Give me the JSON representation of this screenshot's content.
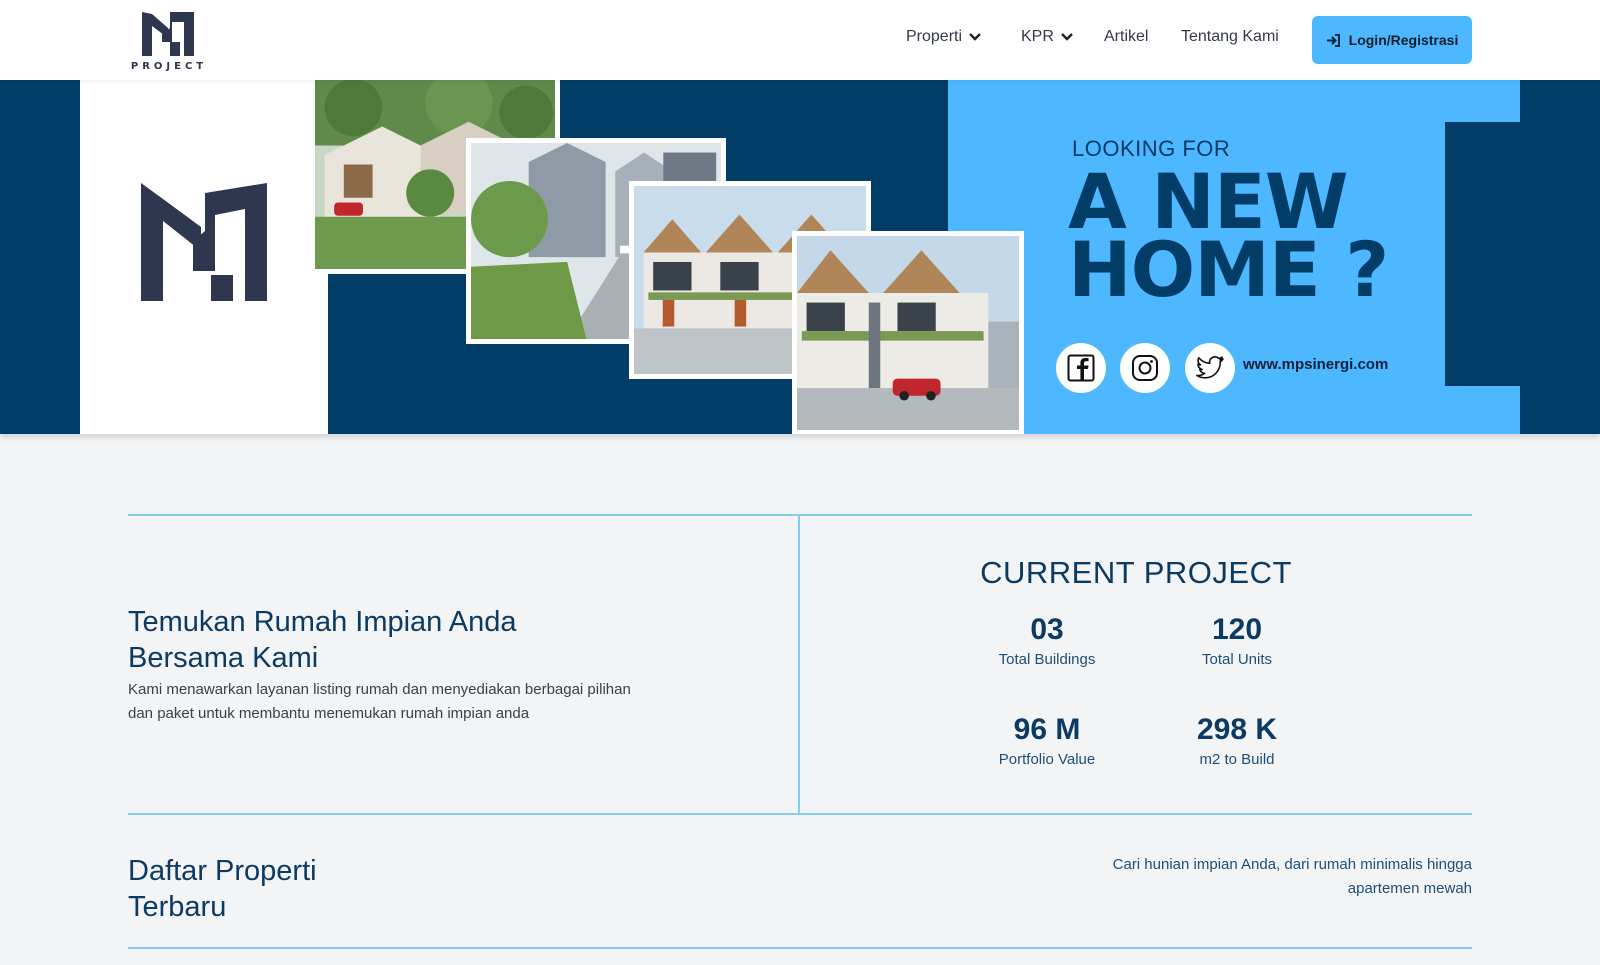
{
  "navbar": {
    "brand_text": "PROJECT",
    "items": [
      {
        "label": "Properti",
        "dropdown": true
      },
      {
        "label": "KPR",
        "dropdown": true
      },
      {
        "label": "Artikel",
        "dropdown": false
      },
      {
        "label": "Tentang Kami",
        "dropdown": false
      }
    ],
    "login_label": "Login/Registrasi",
    "login_icon": "sign-in-icon"
  },
  "hero": {
    "kicker": "LOOKING FOR",
    "title_line1": "A NEW",
    "title_line2": "HOME ?",
    "social_icons": [
      "facebook-icon",
      "instagram-icon",
      "twitter-icon"
    ],
    "website": "www.mpsinergi.com"
  },
  "intro": {
    "title_line1": "Temukan Rumah Impian Anda",
    "title_line2": "Bersama Kami",
    "description_line1": "Kami menawarkan layanan listing rumah dan menyediakan berbagai pilihan",
    "description_line2": "dan paket untuk membantu menemukan rumah impian anda"
  },
  "stats": {
    "title": "CURRENT PROJECT",
    "items": [
      {
        "value": "03",
        "label": "Total Buildings"
      },
      {
        "value": "120",
        "label": "Total Units"
      },
      {
        "value": "96 M",
        "label": "Portfolio Value"
      },
      {
        "value": "298 K",
        "label": "m2 to Build"
      }
    ]
  },
  "listing": {
    "title_line1": "Daftar Properti",
    "title_line2": "Terbaru",
    "description_line1": "Cari hunian impian Anda, dari rumah minimalis hingga",
    "description_line2": "apartemen mewah"
  },
  "colors": {
    "navy": "#023d67",
    "sky": "#4db8ff",
    "divider": "#86c9f2",
    "background": "#f2f4f6"
  }
}
